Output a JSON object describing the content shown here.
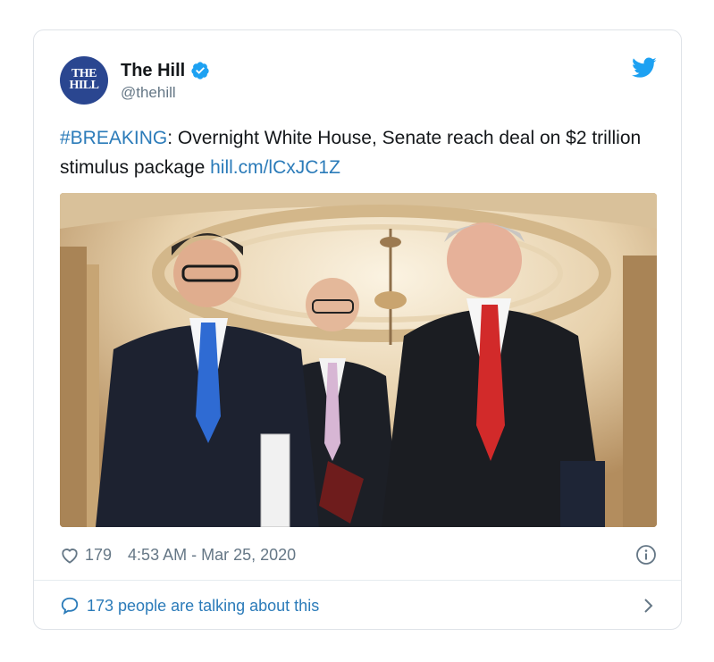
{
  "account": {
    "avatar_line1": "THE",
    "avatar_line2": "HILL",
    "display_name": "The Hill",
    "handle": "@thehill"
  },
  "tweet": {
    "hashtag": "#BREAKING",
    "text_before_link": ": Overnight White House, Senate reach deal on $2 trillion stimulus package ",
    "link": "hill.cm/lCxJC1Z"
  },
  "meta": {
    "like_count": "179",
    "timestamp": "4:53 AM - Mar 25, 2020"
  },
  "footer": {
    "talking_label": "173 people are talking about this"
  },
  "icons": {
    "verified": "verified-badge-icon",
    "brand": "twitter-bird-icon",
    "like": "heart-outline-icon",
    "info": "info-circle-icon",
    "reply": "speech-bubble-icon",
    "more": "chevron-right-icon"
  },
  "colors": {
    "link": "#2b7bb9",
    "secondary_text": "#657786",
    "verified": "#1da1f2",
    "avatar_bg": "#2a4690",
    "border": "#dfe3e8"
  }
}
